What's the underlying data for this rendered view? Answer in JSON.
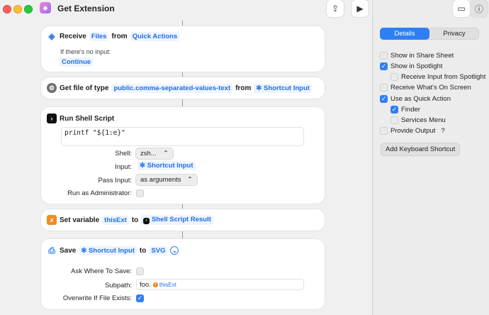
{
  "window": {
    "title": "Get Extension"
  },
  "sidebar": {
    "tabs": [
      "Details",
      "Privacy"
    ],
    "options": [
      {
        "label": "Show in Share Sheet",
        "checked": false
      },
      {
        "label": "Show in Spotlight",
        "checked": true
      },
      {
        "label": "Receive Input from Spotlight",
        "checked": false
      },
      {
        "label": "Receive What's On Screen",
        "checked": false
      },
      {
        "label": "Use as Quick Action",
        "checked": true
      },
      {
        "label": "Finder",
        "checked": true
      },
      {
        "label": "Services Menu",
        "checked": false
      },
      {
        "label": "Provide Output",
        "checked": false
      }
    ],
    "help_glyph": "?",
    "add_shortcut": "Add Keyboard Shortcut"
  },
  "actions": {
    "receive": {
      "verb": "Receive",
      "type": "Files",
      "from": "from",
      "source": "Quick Actions",
      "no_input": "If there's no input:",
      "fallback": "Continue"
    },
    "get_file": {
      "verb": "Get file of type",
      "type": "public.comma-separated-values-text",
      "from": "from",
      "source": "Shortcut Input"
    },
    "shell": {
      "title": "Run Shell Script",
      "code": "printf \"${1:e}\"",
      "shell_label": "Shell:",
      "shell_value": "zsh...",
      "input_label": "Input:",
      "input_value": "Shortcut Input",
      "pass_label": "Pass Input:",
      "pass_value": "as arguments",
      "admin_label": "Run as Administrator:"
    },
    "set_var": {
      "verb": "Set variable",
      "name": "thisExt",
      "to": "to",
      "value": "Shell Script Result"
    },
    "save": {
      "verb": "Save",
      "input": "Shortcut Input",
      "to": "to",
      "format": "SVG",
      "ask_label": "Ask Where To Save:",
      "subpath_label": "Subpath:",
      "subpath_prefix": "foo.",
      "subpath_var": "thisExt",
      "overwrite_label": "Overwrite If File Exists:"
    }
  }
}
